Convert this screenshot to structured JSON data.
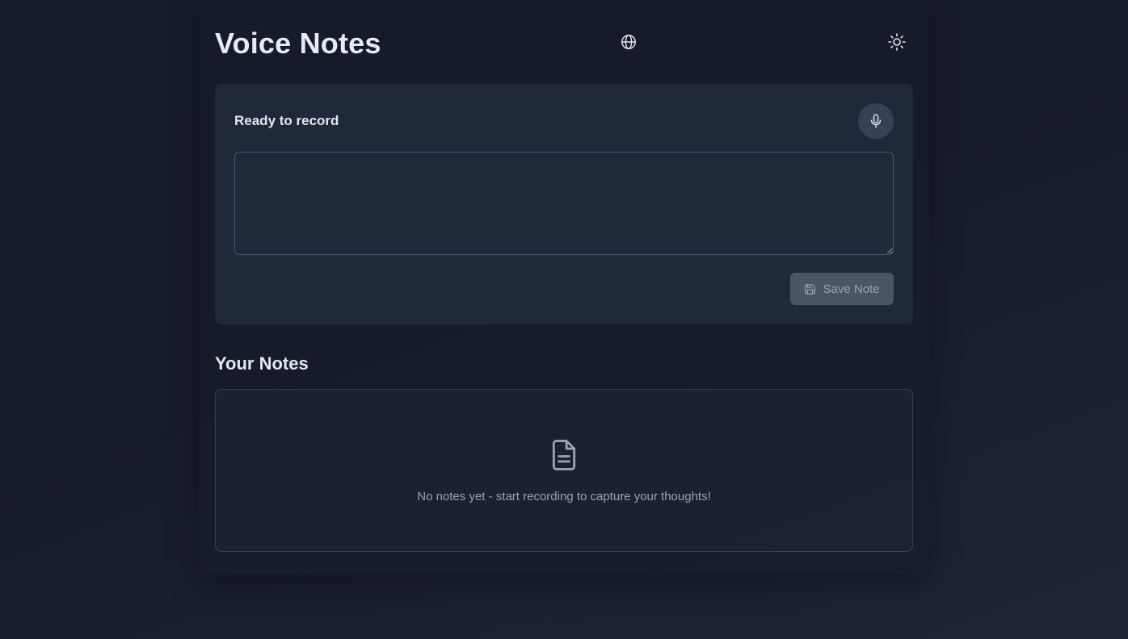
{
  "header": {
    "title": "Voice Notes",
    "language_icon": "globe-icon",
    "theme_icon": "sun-icon"
  },
  "recorder": {
    "status": "Ready to record",
    "mic_icon": "microphone-icon",
    "transcript_value": "",
    "transcript_placeholder": "",
    "save_label": "Save Note",
    "save_icon": "floppy-disk-icon"
  },
  "notes": {
    "heading": "Your Notes",
    "empty_icon": "document-icon",
    "empty_message": "No notes yet - start recording to capture your thoughts!"
  },
  "colors": {
    "background": "#171c2c",
    "card": "#1f293a",
    "mic_button": "#354154",
    "save_button_disabled": "#4a5566",
    "text_primary": "#e5e7eb",
    "text_muted": "#9ca3af"
  }
}
